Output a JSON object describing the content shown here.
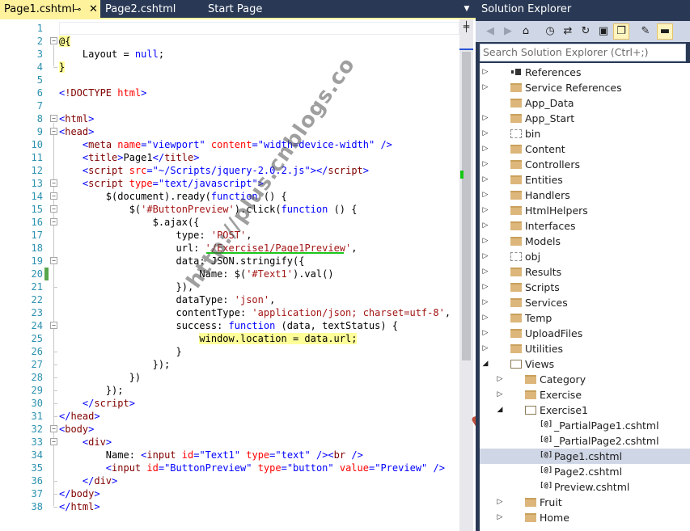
{
  "tabs": [
    {
      "label": "Page1.cshtml",
      "active": true
    },
    {
      "label": "Page2.cshtml",
      "active": false
    },
    {
      "label": "Start Page",
      "active": false
    }
  ],
  "editor": {
    "lines": [
      {
        "n": "1",
        "h": ""
      },
      {
        "n": "2",
        "h": "<span class='hl'>@{</span>"
      },
      {
        "n": "3",
        "h": "    Layout = <span class='k'>null</span>;"
      },
      {
        "n": "4",
        "h": "<span class='hl'>}</span>"
      },
      {
        "n": "5",
        "h": ""
      },
      {
        "n": "6",
        "h": "<span class='d'>&lt;</span><span class='tg'>!DOCTYPE</span> <span class='at'>html</span><span class='d'>&gt;</span>"
      },
      {
        "n": "7",
        "h": ""
      },
      {
        "n": "8",
        "h": "<span class='d'>&lt;</span><span class='tg'>html</span><span class='d'>&gt;</span>"
      },
      {
        "n": "9",
        "h": "<span class='d'>&lt;</span><span class='tg'>head</span><span class='d'>&gt;</span>"
      },
      {
        "n": "10",
        "h": "    <span class='d'>&lt;</span><span class='tg'>meta</span> <span class='at'>name</span><span class='d'>=</span><span class='av'>\"viewport\"</span> <span class='at'>content</span><span class='d'>=</span><span class='av'>\"width=device-width\"</span> <span class='d'>/&gt;</span>"
      },
      {
        "n": "11",
        "h": "    <span class='d'>&lt;</span><span class='tg'>title</span><span class='d'>&gt;</span>Page1<span class='d'>&lt;/</span><span class='tg'>title</span><span class='d'>&gt;</span>"
      },
      {
        "n": "12",
        "h": "    <span class='d'>&lt;</span><span class='tg'>script</span> <span class='at'>src</span><span class='d'>=</span><span class='av'>\"~/Scripts/jquery-2.0.2.js\"</span><span class='d'>&gt;&lt;/</span><span class='tg'>script</span><span class='d'>&gt;</span>"
      },
      {
        "n": "13",
        "h": "    <span class='d'>&lt;</span><span class='tg'>script</span> <span class='at'>type</span><span class='d'>=</span><span class='av'>\"text/javascript\"</span><span class='d'>&gt;</span>"
      },
      {
        "n": "14",
        "h": "        $(document).ready(<span class='k'>function</span> () {"
      },
      {
        "n": "15",
        "h": "            $(<span class='s'>'#ButtonPreview'</span>).click(<span class='k'>function</span> () {"
      },
      {
        "n": "16",
        "h": "                $.ajax({"
      },
      {
        "n": "17",
        "h": "                    type: <span class='s'>'POST'</span>,"
      },
      {
        "n": "18",
        "h": "                    url: <span class='s'>'/Exercise1/Page1Preview'</span>,"
      },
      {
        "n": "19",
        "h": "                    data: JSON.stringify({"
      },
      {
        "n": "20",
        "h": "                        Name: $(<span class='s'>'#Text1'</span>).val()"
      },
      {
        "n": "21",
        "h": "                    }),"
      },
      {
        "n": "22",
        "h": "                    dataType: <span class='s'>'json'</span>,"
      },
      {
        "n": "23",
        "h": "                    contentType: <span class='s'>'application/json; charset=utf-8'</span>,"
      },
      {
        "n": "24",
        "h": "                    success: <span class='k'>function</span> (data, textStatus) {"
      },
      {
        "n": "25",
        "h": "                        <span class='hl'>window.location = data.url;</span>"
      },
      {
        "n": "26",
        "h": "                    }"
      },
      {
        "n": "27",
        "h": "                });"
      },
      {
        "n": "28",
        "h": "            })"
      },
      {
        "n": "29",
        "h": "        });"
      },
      {
        "n": "30",
        "h": "    <span class='d'>&lt;/</span><span class='tg'>script</span><span class='d'>&gt;</span>"
      },
      {
        "n": "31",
        "h": "<span class='d'>&lt;/</span><span class='tg'>head</span><span class='d'>&gt;</span>"
      },
      {
        "n": "32",
        "h": "<span class='d'>&lt;</span><span class='tg'>body</span><span class='d'>&gt;</span>"
      },
      {
        "n": "33",
        "h": "    <span class='d'>&lt;</span><span class='tg'>div</span><span class='d'>&gt;</span>"
      },
      {
        "n": "34",
        "h": "        Name: <span class='d'>&lt;</span><span class='tg'>input</span> <span class='at'>id</span><span class='d'>=</span><span class='av'>\"Text1\"</span> <span class='at'>type</span><span class='d'>=</span><span class='av'>\"text\"</span> <span class='d'>/&gt;&lt;</span><span class='tg'>br</span> <span class='d'>/&gt;</span>"
      },
      {
        "n": "35",
        "h": "        <span class='d'>&lt;</span><span class='tg'>input</span> <span class='at'>id</span><span class='d'>=</span><span class='av'>\"ButtonPreview\"</span> <span class='at'>type</span><span class='d'>=</span><span class='av'>\"button\"</span> <span class='at'>value</span><span class='d'>=</span><span class='av'>\"Preview\"</span> <span class='d'>/&gt;</span>"
      },
      {
        "n": "36",
        "h": "    <span class='d'>&lt;/</span><span class='tg'>div</span><span class='d'>&gt;</span>"
      },
      {
        "n": "37",
        "h": "<span class='d'>&lt;/</span><span class='tg'>body</span><span class='d'>&gt;</span>"
      },
      {
        "n": "38",
        "h": "<span class='d'>&lt;/</span><span class='tg'>html</span><span class='d'>&gt;</span>"
      }
    ]
  },
  "watermark": "http://plus.cnblogs.co",
  "solution_explorer": {
    "title": "Solution Explorer",
    "search_placeholder": "Search Solution Explorer (Ctrl+;)",
    "toolbar_icons": [
      "back-icon",
      "forward-icon",
      "home-icon",
      "history-icon",
      "sync-icon",
      "refresh-icon",
      "collapse-all-icon",
      "show-all-files-icon",
      "properties-icon",
      "preview-icon"
    ],
    "items": [
      {
        "label": "References",
        "type": "refs",
        "depth": 0,
        "expander": "collapsed"
      },
      {
        "label": "Service References",
        "type": "folder",
        "depth": 0,
        "expander": "collapsed"
      },
      {
        "label": "App_Data",
        "type": "folder",
        "depth": 0,
        "expander": "none"
      },
      {
        "label": "App_Start",
        "type": "folder",
        "depth": 0,
        "expander": "collapsed"
      },
      {
        "label": "bin",
        "type": "folder-dashed",
        "depth": 0,
        "expander": "collapsed"
      },
      {
        "label": "Content",
        "type": "folder",
        "depth": 0,
        "expander": "collapsed"
      },
      {
        "label": "Controllers",
        "type": "folder",
        "depth": 0,
        "expander": "collapsed"
      },
      {
        "label": "Entities",
        "type": "folder",
        "depth": 0,
        "expander": "collapsed"
      },
      {
        "label": "Handlers",
        "type": "folder",
        "depth": 0,
        "expander": "collapsed"
      },
      {
        "label": "HtmlHelpers",
        "type": "folder",
        "depth": 0,
        "expander": "collapsed"
      },
      {
        "label": "Interfaces",
        "type": "folder",
        "depth": 0,
        "expander": "collapsed"
      },
      {
        "label": "Models",
        "type": "folder",
        "depth": 0,
        "expander": "collapsed"
      },
      {
        "label": "obj",
        "type": "folder-dashed",
        "depth": 0,
        "expander": "collapsed"
      },
      {
        "label": "Results",
        "type": "folder",
        "depth": 0,
        "expander": "collapsed"
      },
      {
        "label": "Scripts",
        "type": "folder",
        "depth": 0,
        "expander": "collapsed"
      },
      {
        "label": "Services",
        "type": "folder",
        "depth": 0,
        "expander": "collapsed"
      },
      {
        "label": "Temp",
        "type": "folder",
        "depth": 0,
        "expander": "collapsed"
      },
      {
        "label": "UploadFiles",
        "type": "folder",
        "depth": 0,
        "expander": "collapsed"
      },
      {
        "label": "Utilities",
        "type": "folder",
        "depth": 0,
        "expander": "collapsed"
      },
      {
        "label": "Views",
        "type": "folder-open",
        "depth": 0,
        "expander": "expanded"
      },
      {
        "label": "Category",
        "type": "folder",
        "depth": 1,
        "expander": "collapsed"
      },
      {
        "label": "Exercise",
        "type": "folder",
        "depth": 1,
        "expander": "collapsed"
      },
      {
        "label": "Exercise1",
        "type": "folder-open",
        "depth": 1,
        "expander": "expanded"
      },
      {
        "label": "_PartialPage1.cshtml",
        "type": "cshtml",
        "depth": 2,
        "expander": "none"
      },
      {
        "label": "_PartialPage2.cshtml",
        "type": "cshtml",
        "depth": 2,
        "expander": "none"
      },
      {
        "label": "Page1.cshtml",
        "type": "cshtml",
        "depth": 2,
        "expander": "none",
        "selected": true
      },
      {
        "label": "Page2.cshtml",
        "type": "cshtml",
        "depth": 2,
        "expander": "none"
      },
      {
        "label": "Preview.cshtml",
        "type": "cshtml",
        "depth": 2,
        "expander": "none"
      },
      {
        "label": "Fruit",
        "type": "folder",
        "depth": 1,
        "expander": "collapsed"
      },
      {
        "label": "Home",
        "type": "folder",
        "depth": 1,
        "expander": "collapsed"
      }
    ]
  },
  "colors": {
    "accent": "#fff29d",
    "chrome": "#293955",
    "arrow": "#c0503a",
    "green_marker": "#1cc71c"
  }
}
